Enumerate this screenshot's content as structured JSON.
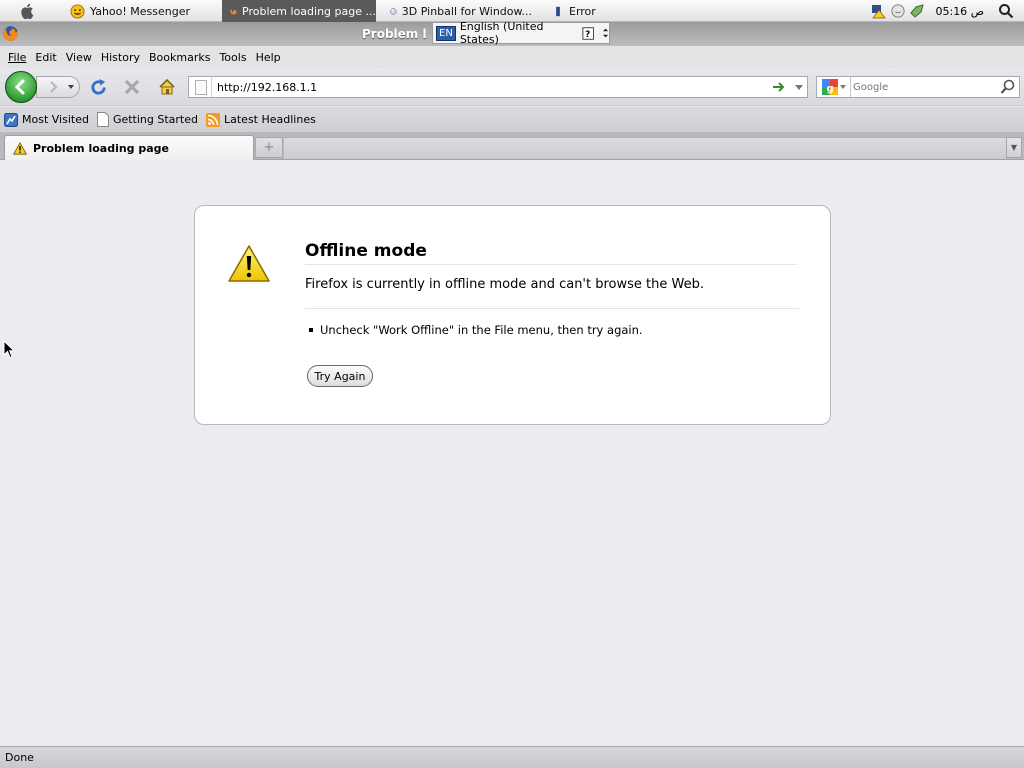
{
  "taskbar": {
    "tasks": [
      {
        "label": "Yahoo! Messenger",
        "icon": "smiley-icon"
      },
      {
        "label": "Problem loading page ...",
        "icon": "firefox-icon",
        "active": true
      },
      {
        "label": "3D Pinball for Window...",
        "icon": "pinball-icon"
      },
      {
        "label": "Error",
        "icon": "error-icon"
      }
    ],
    "clock": "05:16 ص"
  },
  "window": {
    "title": "Problem l",
    "language_popup": {
      "badge": "EN",
      "label": "English (United States)"
    }
  },
  "menu": [
    "File",
    "Edit",
    "View",
    "History",
    "Bookmarks",
    "Tools",
    "Help"
  ],
  "navbar": {
    "url": "http://192.168.1.1",
    "search_placeholder": "Google"
  },
  "bookmarks": [
    "Most Visited",
    "Getting Started",
    "Latest Headlines"
  ],
  "tab": {
    "label": "Problem loading page"
  },
  "error": {
    "title": "Offline mode",
    "description": "Firefox is currently in offline mode and can't browse the Web.",
    "hint": "Uncheck \"Work Offline\" in the File menu, then try again.",
    "button": "Try Again"
  },
  "status": "Done",
  "colors": {
    "warning_yellow": "#f4d21d",
    "back_green": "#2f9a2f",
    "reload_blue": "#2f6fd1"
  }
}
